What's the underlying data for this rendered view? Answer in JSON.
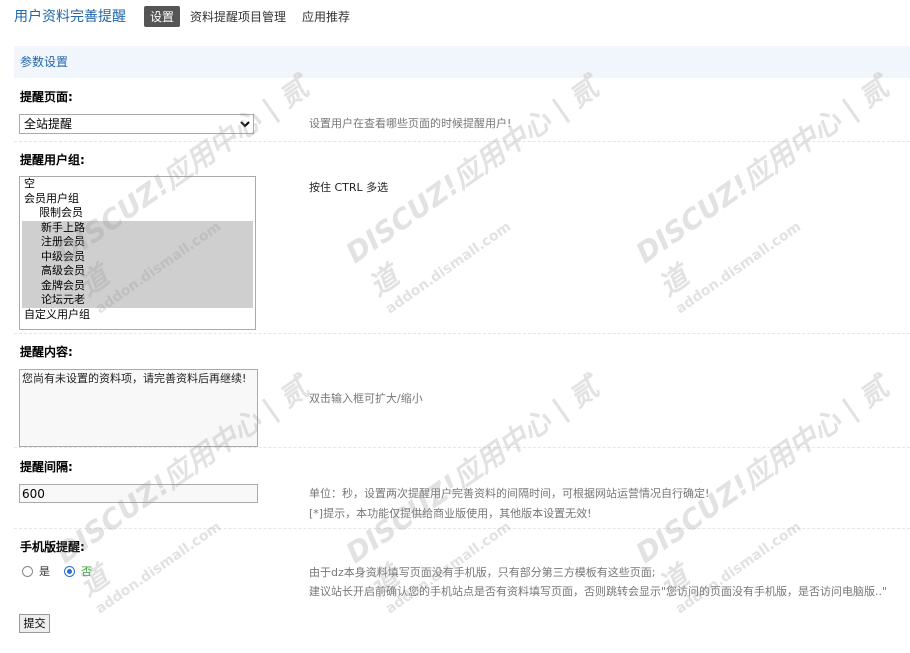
{
  "header": {
    "title": "用户资料完善提醒",
    "tabs": [
      {
        "label": "设置",
        "active": true
      },
      {
        "label": "资料提醒项目管理",
        "active": false
      },
      {
        "label": "应用推荐",
        "active": false
      }
    ]
  },
  "section": {
    "title": "参数设置"
  },
  "fields": {
    "remind_page": {
      "label": "提醒页面:",
      "value": "全站提醒",
      "hint": "设置用户在查看哪些页面的时候提醒用户!"
    },
    "user_groups": {
      "label": "提醒用户组:",
      "hint": "按住 CTRL 多选",
      "options": [
        {
          "label": "空",
          "indent": false,
          "selected": false
        },
        {
          "label": "会员用户组",
          "indent": false,
          "selected": false
        },
        {
          "label": "限制会员",
          "indent": true,
          "selected": false
        },
        {
          "label": "新手上路",
          "indent": true,
          "selected": true
        },
        {
          "label": "注册会员",
          "indent": true,
          "selected": true
        },
        {
          "label": "中级会员",
          "indent": true,
          "selected": true
        },
        {
          "label": "高级会员",
          "indent": true,
          "selected": true
        },
        {
          "label": "金牌会员",
          "indent": true,
          "selected": true
        },
        {
          "label": "论坛元老",
          "indent": true,
          "selected": true
        },
        {
          "label": "自定义用户组",
          "indent": false,
          "selected": false
        }
      ]
    },
    "content": {
      "label": "提醒内容:",
      "value": "您尚有未设置的资料项，请完善资料后再继续!",
      "hint": "双击输入框可扩大/缩小"
    },
    "interval": {
      "label": "提醒间隔:",
      "value": "600",
      "hint_line1": "单位：秒，设置两次提醒用户完善资料的间隔时间，可根据网站运营情况自行确定!",
      "hint_line2": "[*]提示，本功能仅提供给商业版使用，其他版本设置无效!"
    },
    "mobile": {
      "label": "手机版提醒:",
      "option_yes": "是",
      "option_no": "否",
      "selected": "否",
      "hint_line1": "由于dz本身资料填写页面没有手机版，只有部分第三方模板有这些页面;",
      "hint_line2": "建议站长开启前确认您的手机站点是否有资料填写页面，否则跳转会显示\"您访问的页面没有手机版，是否访问电脑版..\""
    }
  },
  "submit_label": "提交",
  "watermark": {
    "line1": "DISCUZ!应用中心 | 贰道",
    "line2": "addon.dismall.com"
  }
}
